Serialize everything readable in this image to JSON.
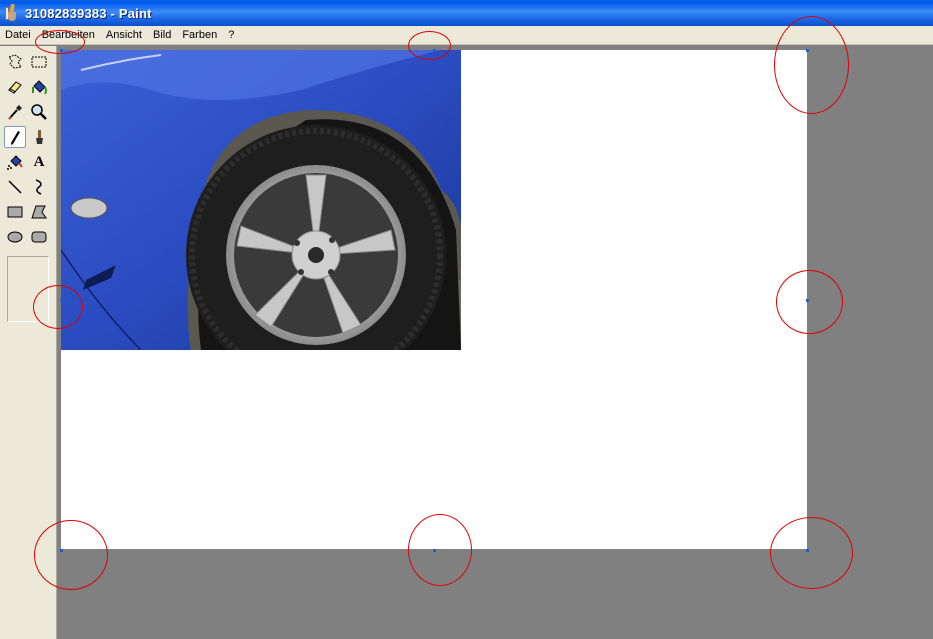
{
  "window": {
    "title": "31082839383 - Paint"
  },
  "menu": {
    "items": [
      {
        "label": "Datei"
      },
      {
        "label": "Bearbeiten"
      },
      {
        "label": "Ansicht"
      },
      {
        "label": "Bild"
      },
      {
        "label": "Farben"
      },
      {
        "label": "?"
      }
    ]
  },
  "toolbox": {
    "tools": [
      {
        "name": "free-form-select",
        "icon": "free-form-select-icon"
      },
      {
        "name": "rectangle-select",
        "icon": "rectangle-select-icon"
      },
      {
        "name": "eraser",
        "icon": "eraser-icon"
      },
      {
        "name": "fill-bucket",
        "icon": "fill-bucket-icon"
      },
      {
        "name": "color-picker",
        "icon": "eyedropper-icon"
      },
      {
        "name": "magnifier",
        "icon": "magnifier-icon"
      },
      {
        "name": "pencil",
        "icon": "pencil-icon",
        "active": true
      },
      {
        "name": "brush",
        "icon": "brush-icon"
      },
      {
        "name": "airbrush",
        "icon": "airbrush-icon"
      },
      {
        "name": "text",
        "icon": "text-icon",
        "glyph": "A"
      },
      {
        "name": "line",
        "icon": "line-icon"
      },
      {
        "name": "curve",
        "icon": "curve-icon"
      },
      {
        "name": "rectangle",
        "icon": "rectangle-icon"
      },
      {
        "name": "polygon",
        "icon": "polygon-icon"
      },
      {
        "name": "ellipse",
        "icon": "ellipse-icon"
      },
      {
        "name": "rounded-rectangle",
        "icon": "rounded-rectangle-icon"
      }
    ]
  },
  "canvas": {
    "image_content": "blue car wheel photo"
  },
  "colors": {
    "titlebar": "#0058ee",
    "menubar": "#ece9d8",
    "workspace": "#808080",
    "annotation": "#e00000",
    "handle": "#1f5fd0"
  }
}
